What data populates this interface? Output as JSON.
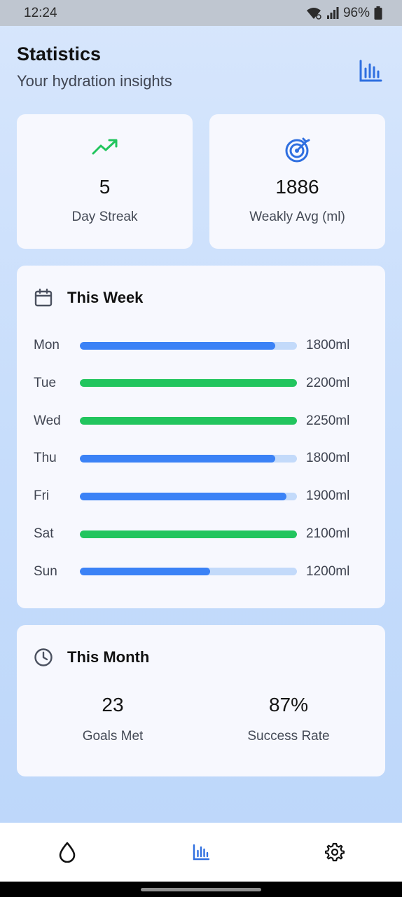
{
  "status_bar": {
    "time": "12:24",
    "battery": "96%"
  },
  "header": {
    "title": "Statistics",
    "subtitle": "Your hydration insights",
    "icon": "bar-chart-icon"
  },
  "stats": [
    {
      "value": "5",
      "label": "Day Streak",
      "icon": "trending-up-icon",
      "color": "#22c55e"
    },
    {
      "value": "1886",
      "label": "Weakly Avg (ml)",
      "icon": "target-icon",
      "color": "#2f6fe0"
    }
  ],
  "week": {
    "title": "This Week",
    "icon": "calendar-icon",
    "goal_ml": 2000,
    "colors": {
      "met": "#22c55e",
      "under": "#3b82f6",
      "track": "#c3dafa"
    },
    "days": [
      {
        "day": "Mon",
        "amount": "1800ml",
        "progress": 0.9,
        "met": false
      },
      {
        "day": "Tue",
        "amount": "2200ml",
        "progress": 1.0,
        "met": true
      },
      {
        "day": "Wed",
        "amount": "2250ml",
        "progress": 1.0,
        "met": true
      },
      {
        "day": "Thu",
        "amount": "1800ml",
        "progress": 0.9,
        "met": false
      },
      {
        "day": "Fri",
        "amount": "1900ml",
        "progress": 0.95,
        "met": false
      },
      {
        "day": "Sat",
        "amount": "2100ml",
        "progress": 1.0,
        "met": true
      },
      {
        "day": "Sun",
        "amount": "1200ml",
        "progress": 0.6,
        "met": false
      }
    ]
  },
  "month": {
    "title": "This Month",
    "icon": "clock-icon",
    "stats": [
      {
        "value": "23",
        "label": "Goals Met"
      },
      {
        "value": "87%",
        "label": "Success Rate"
      }
    ]
  },
  "bottom_nav": {
    "items": [
      {
        "icon": "water-drop-icon",
        "active": false
      },
      {
        "icon": "bar-chart-icon",
        "active": true
      },
      {
        "icon": "settings-gear-icon",
        "active": false
      }
    ],
    "active_color": "#2f6fe0",
    "inactive_color": "#111111"
  }
}
